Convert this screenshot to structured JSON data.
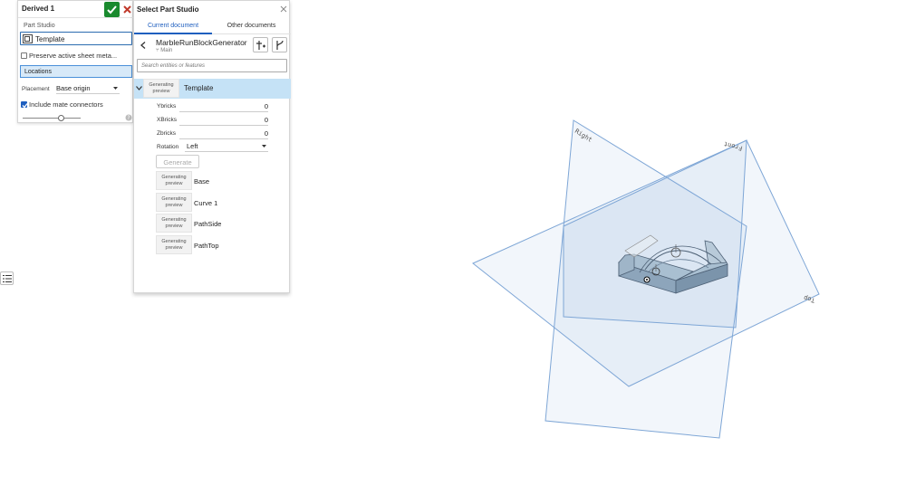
{
  "derived": {
    "title": "Derived 1",
    "part_studio_label": "Part Studio",
    "template_value": "Template",
    "preserve_label": "Preserve active sheet meta...",
    "locations_label": "Locations",
    "placement_label": "Placement",
    "placement_value": "Base origin",
    "include_mate_label": "Include mate connectors",
    "include_mate_checked": true,
    "preserve_checked": false,
    "slider_value": 0.67
  },
  "dialog": {
    "title": "Select Part Studio",
    "tabs": [
      "Current document",
      "Other documents"
    ],
    "doc_name": "MarbleRunBlockGenerator",
    "branch": "Main",
    "search_placeholder": "Search entities or features",
    "template_feature": "Template",
    "thumb_text": "Generating preview",
    "params": [
      {
        "label": "Ybricks",
        "value": "0"
      },
      {
        "label": "XBricks",
        "value": "0"
      },
      {
        "label": "Zbricks",
        "value": "0"
      }
    ],
    "rotation_label": "Rotation",
    "rotation_value": "Left",
    "generate_label": "Generate",
    "features": [
      "Base",
      "Curve 1",
      "PathSide",
      "PathTop"
    ]
  },
  "viewport": {
    "plane_labels": [
      "Right",
      "Front",
      "Top"
    ],
    "plane_color": "#7ea6d6",
    "part_color": "#8fa9bf"
  }
}
